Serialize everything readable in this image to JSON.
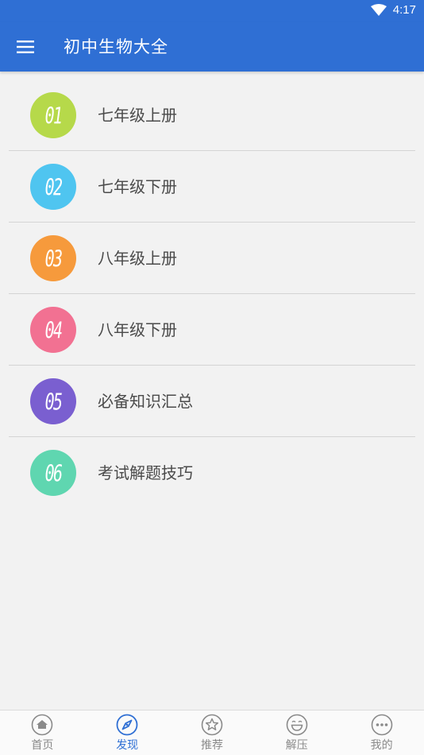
{
  "status_bar": {
    "time": "4:17",
    "wifi_icon": "wifi-icon"
  },
  "app_bar": {
    "title": "初中生物大全",
    "menu_icon": "hamburger-menu-icon"
  },
  "colors": {
    "primary": "#2f6fd4",
    "badge_1": "#b6d94a",
    "badge_2": "#4fc5f0",
    "badge_3": "#f69a3c",
    "badge_4": "#f27192",
    "badge_5": "#7a5fd0",
    "badge_6": "#5fd6b0"
  },
  "list": {
    "items": [
      {
        "badge": "01",
        "label": "七年级上册"
      },
      {
        "badge": "02",
        "label": "七年级下册"
      },
      {
        "badge": "03",
        "label": "八年级上册"
      },
      {
        "badge": "04",
        "label": "八年级下册"
      },
      {
        "badge": "05",
        "label": "必备知识汇总"
      },
      {
        "badge": "06",
        "label": "考试解题技巧"
      }
    ]
  },
  "bottom_nav": {
    "items": [
      {
        "label": "首页",
        "icon": "home-icon",
        "active": false
      },
      {
        "label": "发现",
        "icon": "compass-icon",
        "active": true
      },
      {
        "label": "推荐",
        "icon": "star-icon",
        "active": false
      },
      {
        "label": "解压",
        "icon": "smile-icon",
        "active": false
      },
      {
        "label": "我的",
        "icon": "more-dots-icon",
        "active": false
      }
    ]
  }
}
